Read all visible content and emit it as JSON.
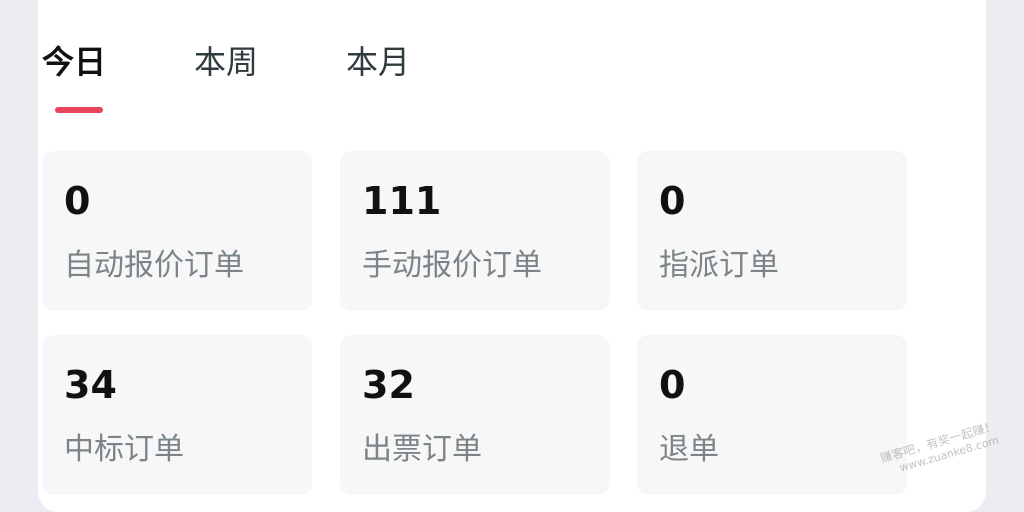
{
  "tabs": [
    {
      "label": "今日",
      "active": true
    },
    {
      "label": "本周",
      "active": false
    },
    {
      "label": "本月",
      "active": false
    }
  ],
  "colors": {
    "active_underline": "#e8455a",
    "card_bg": "#f7f7f9",
    "label_text": "#7c8585",
    "page_bg": "#ececf3"
  },
  "stats": [
    {
      "value": "0",
      "label": "自动报价订单"
    },
    {
      "value": "111",
      "label": "手动报价订单"
    },
    {
      "value": "0",
      "label": "指派订单"
    },
    {
      "value": "34",
      "label": "中标订单"
    },
    {
      "value": "32",
      "label": "出票订单"
    },
    {
      "value": "0",
      "label": "退单"
    }
  ],
  "watermark": {
    "text": "赚客吧，有奖一起赚！",
    "url": "www.zuanke8.com"
  }
}
